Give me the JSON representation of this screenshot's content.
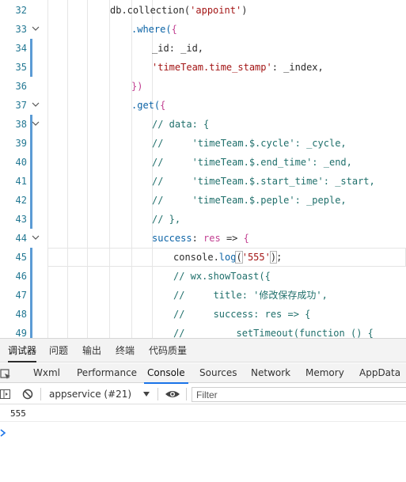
{
  "editor": {
    "lines": [
      {
        "num": "32",
        "fold": false,
        "mod": false,
        "tokens": [
          {
            "t": "db.collection(",
            "c": "k-var"
          },
          {
            "t": "'appoint'",
            "c": "k-str"
          },
          {
            "t": ")",
            "c": "k-var"
          }
        ]
      },
      {
        "num": "33",
        "fold": true,
        "mod": false,
        "tokens": [
          {
            "t": ".where(",
            "c": "k-fn"
          },
          {
            "t": "{",
            "c": "k-par"
          }
        ]
      },
      {
        "num": "34",
        "fold": false,
        "mod": true,
        "tokens": [
          {
            "t": "_id",
            "c": "k-var"
          },
          {
            "t": ": _id,",
            "c": "k-var"
          }
        ]
      },
      {
        "num": "35",
        "fold": false,
        "mod": true,
        "tokens": [
          {
            "t": "'timeTeam.time_stamp'",
            "c": "k-str"
          },
          {
            "t": ": _index,",
            "c": "k-var"
          }
        ]
      },
      {
        "num": "36",
        "fold": false,
        "mod": false,
        "tokens": [
          {
            "t": "})",
            "c": "k-par"
          }
        ]
      },
      {
        "num": "37",
        "fold": true,
        "mod": false,
        "tokens": [
          {
            "t": ".get(",
            "c": "k-fn"
          },
          {
            "t": "{",
            "c": "k-par"
          }
        ]
      },
      {
        "num": "38",
        "fold": true,
        "mod": true,
        "tokens": [
          {
            "t": "// data: {",
            "c": "k-cm"
          }
        ]
      },
      {
        "num": "39",
        "fold": false,
        "mod": true,
        "tokens": [
          {
            "t": "//     'timeTeam.$.cycle': _cycle,",
            "c": "k-cm"
          }
        ]
      },
      {
        "num": "40",
        "fold": false,
        "mod": true,
        "tokens": [
          {
            "t": "//     'timeTeam.$.end_time': _end,",
            "c": "k-cm"
          }
        ]
      },
      {
        "num": "41",
        "fold": false,
        "mod": true,
        "tokens": [
          {
            "t": "//     'timeTeam.$.start_time': _start,",
            "c": "k-cm"
          }
        ]
      },
      {
        "num": "42",
        "fold": false,
        "mod": true,
        "tokens": [
          {
            "t": "//     'timeTeam.$.peple': _peple,",
            "c": "k-cm"
          }
        ]
      },
      {
        "num": "43",
        "fold": false,
        "mod": true,
        "tokens": [
          {
            "t": "// },",
            "c": "k-cm"
          }
        ]
      },
      {
        "num": "44",
        "fold": true,
        "mod": false,
        "tokens": [
          {
            "t": "success",
            "c": "k-prop"
          },
          {
            "t": ": ",
            "c": "k-var"
          },
          {
            "t": "res",
            "c": "k-par"
          },
          {
            "t": " => ",
            "c": "k-arrow"
          },
          {
            "t": "{",
            "c": "k-par"
          }
        ]
      },
      {
        "num": "45",
        "fold": false,
        "mod": true,
        "current": true,
        "tokens": [
          {
            "t": "console.",
            "c": "k-var"
          },
          {
            "t": "log",
            "c": "k-fn"
          },
          {
            "t": "(",
            "c": "k-var hl-paren"
          },
          {
            "t": "'555'",
            "c": "k-str"
          },
          {
            "t": ")",
            "c": "k-var hl-paren"
          },
          {
            "t": ";",
            "c": "k-var"
          }
        ]
      },
      {
        "num": "46",
        "fold": false,
        "mod": true,
        "tokens": [
          {
            "t": "// wx.showToast({",
            "c": "k-cm"
          }
        ]
      },
      {
        "num": "47",
        "fold": false,
        "mod": true,
        "tokens": [
          {
            "t": "//     title: '修改保存成功',",
            "c": "k-cm"
          }
        ]
      },
      {
        "num": "48",
        "fold": false,
        "mod": true,
        "tokens": [
          {
            "t": "//     success: res => {",
            "c": "k-cm"
          }
        ]
      },
      {
        "num": "49",
        "fold": false,
        "mod": true,
        "tokens": [
          {
            "t": "//         setTimeout(function () {",
            "c": "k-cm"
          }
        ]
      }
    ]
  },
  "devtools": {
    "top_tabs": [
      "调试器",
      "问题",
      "输出",
      "终端",
      "代码质量"
    ],
    "panel_tabs": [
      "Wxml",
      "Performance",
      "Console",
      "Sources",
      "Network",
      "Memory",
      "AppData"
    ],
    "active_panel": "Console",
    "context_select": "appservice (#21)",
    "filter_placeholder": "Filter",
    "log_output": "555"
  },
  "colors": {
    "accent": "#1a73e8",
    "modified_gutter": "#5b9bd5",
    "line_number": "#237893"
  }
}
